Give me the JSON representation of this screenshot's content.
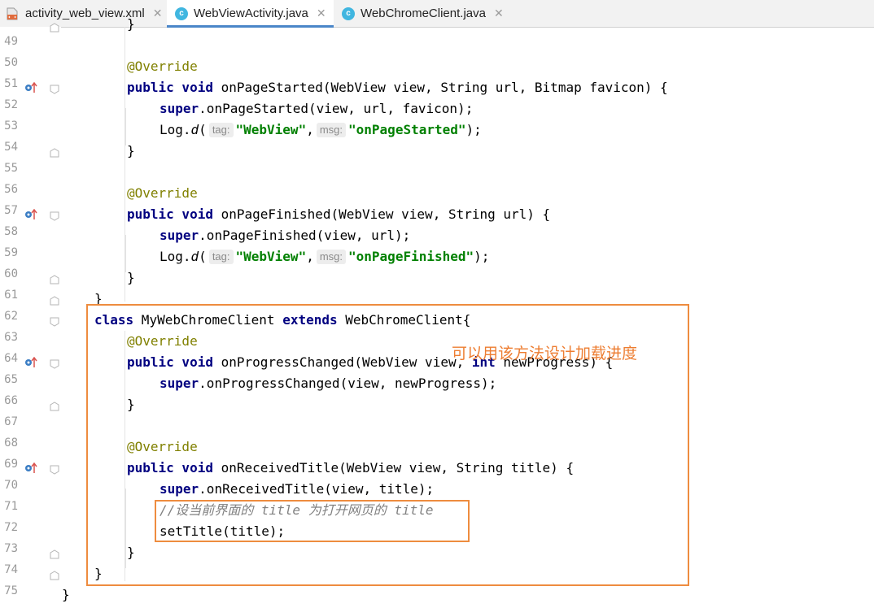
{
  "tabs": [
    {
      "label": "activity_web_view.xml",
      "icon": "xml-file-icon",
      "close": "✕",
      "active": false
    },
    {
      "label": "WebViewActivity.java",
      "icon": "java-class-icon",
      "close": "✕",
      "active": true
    },
    {
      "label": "WebChromeClient.java",
      "icon": "java-class-icon",
      "close": "✕",
      "active": false
    }
  ],
  "java_icon_letter": "c",
  "line_numbers": [
    "49",
    "50",
    "51",
    "52",
    "53",
    "54",
    "55",
    "56",
    "57",
    "58",
    "59",
    "60",
    "61",
    "62",
    "63",
    "64",
    "65",
    "66",
    "67",
    "68",
    "69",
    "70",
    "71",
    "72",
    "73",
    "74",
    "75"
  ],
  "code": {
    "l48": "}",
    "l50": {
      "annotation": "@Override"
    },
    "l51": {
      "kw": "public void",
      "text": " onPageStarted(WebView view, String url, Bitmap favicon) {"
    },
    "l52": {
      "kw": "super",
      "text": ".onPageStarted(view, url, favicon);"
    },
    "l53": {
      "log": "Log.",
      "method": "d",
      "open": "(",
      "tag_hint": "tag:",
      "tag_value": "\"WebView\"",
      "comma": ",",
      "msg_hint": "msg:",
      "msg_value": "\"onPageStarted\"",
      "close": ");"
    },
    "l54": "}",
    "l56": {
      "annotation": "@Override"
    },
    "l57": {
      "kw": "public void",
      "text": " onPageFinished(WebView view, String url) {"
    },
    "l58": {
      "kw": "super",
      "text": ".onPageFinished(view, url);"
    },
    "l59": {
      "log": "Log.",
      "method": "d",
      "open": "(",
      "tag_hint": "tag:",
      "tag_value": "\"WebView\"",
      "comma": ",",
      "msg_hint": "msg:",
      "msg_value": "\"onPageFinished\"",
      "close": ");"
    },
    "l60": "}",
    "l61": "}",
    "l62": {
      "kw": "class",
      "name": " MyWebChromeClient ",
      "kw2": "extends",
      "text": " WebChromeClient{"
    },
    "l63": {
      "annotation": "@Override"
    },
    "l64": {
      "kw": "public void",
      "text1": " onProgressChanged(WebView view, ",
      "kw2": "int",
      "text2": " newProgress) {"
    },
    "l65": {
      "kw": "super",
      "text": ".onProgressChanged(view, newProgress);"
    },
    "l66": "}",
    "l68": {
      "annotation": "@Override"
    },
    "l69": {
      "kw": "public void",
      "text": " onReceivedTitle(WebView view, String title) {"
    },
    "l70": {
      "kw": "super",
      "text": ".onReceivedTitle(view, title);"
    },
    "l71": {
      "comment": "//设当前界面的 title 为打开网页的 title"
    },
    "l72": "setTitle(title);",
    "l73": "}",
    "l74": "}",
    "l75": "}"
  },
  "callout": "可以用该方法设计加载进度",
  "colors": {
    "keyword": "#000080",
    "annotation": "#808000",
    "string": "#008000",
    "comment": "#808080",
    "highlight_box": "#ee8c3f",
    "callout_text": "#ed7d31",
    "active_tab_underline": "#4a86c8"
  }
}
